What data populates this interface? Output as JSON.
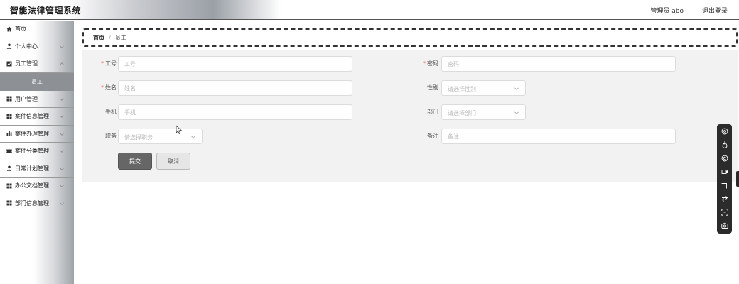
{
  "header": {
    "app_title": "智能法律管理系统",
    "admin_info": "管理员 abo",
    "logout": "退出登录"
  },
  "sidebar": {
    "items": [
      {
        "label": "首页",
        "icon": "home-icon"
      },
      {
        "label": "个人中心",
        "icon": "person-icon"
      },
      {
        "label": "员工管理",
        "icon": "checkbox-icon"
      },
      {
        "label": "用户管理",
        "icon": "grid-icon"
      },
      {
        "label": "案件信息管理",
        "icon": "grid-icon"
      },
      {
        "label": "案件办理管理",
        "icon": "bar-chart-icon"
      },
      {
        "label": "案件分类管理",
        "icon": "ticket-icon"
      },
      {
        "label": "日常计划管理",
        "icon": "person-icon"
      },
      {
        "label": "办公文档管理",
        "icon": "grid-icon"
      },
      {
        "label": "部门信息管理",
        "icon": "grid-icon"
      }
    ],
    "active_sub": "员工"
  },
  "breadcrumb": {
    "home": "首页",
    "sep": "/",
    "current": "员工"
  },
  "form": {
    "gonghao": {
      "label": "工号",
      "placeholder": "工号",
      "required": true
    },
    "mima": {
      "label": "密码",
      "placeholder": "密码",
      "required": true
    },
    "xingming": {
      "label": "姓名",
      "placeholder": "姓名",
      "required": true
    },
    "xingbie": {
      "label": "性别",
      "placeholder": "请选择性别"
    },
    "shouji": {
      "label": "手机",
      "placeholder": "手机"
    },
    "bumen": {
      "label": "部门",
      "placeholder": "请选择部门"
    },
    "zhiwu": {
      "label": "职务",
      "placeholder": "请选择职务"
    },
    "beizhu": {
      "label": "备注",
      "placeholder": "备注"
    },
    "required_mark": "*",
    "submit": "提交",
    "cancel": "取消"
  },
  "toolbar_icons": [
    "search-icon",
    "flame-icon",
    "copyright-icon",
    "video-icon",
    "crop-icon",
    "swap-icon",
    "scan-icon",
    "camera-icon"
  ]
}
